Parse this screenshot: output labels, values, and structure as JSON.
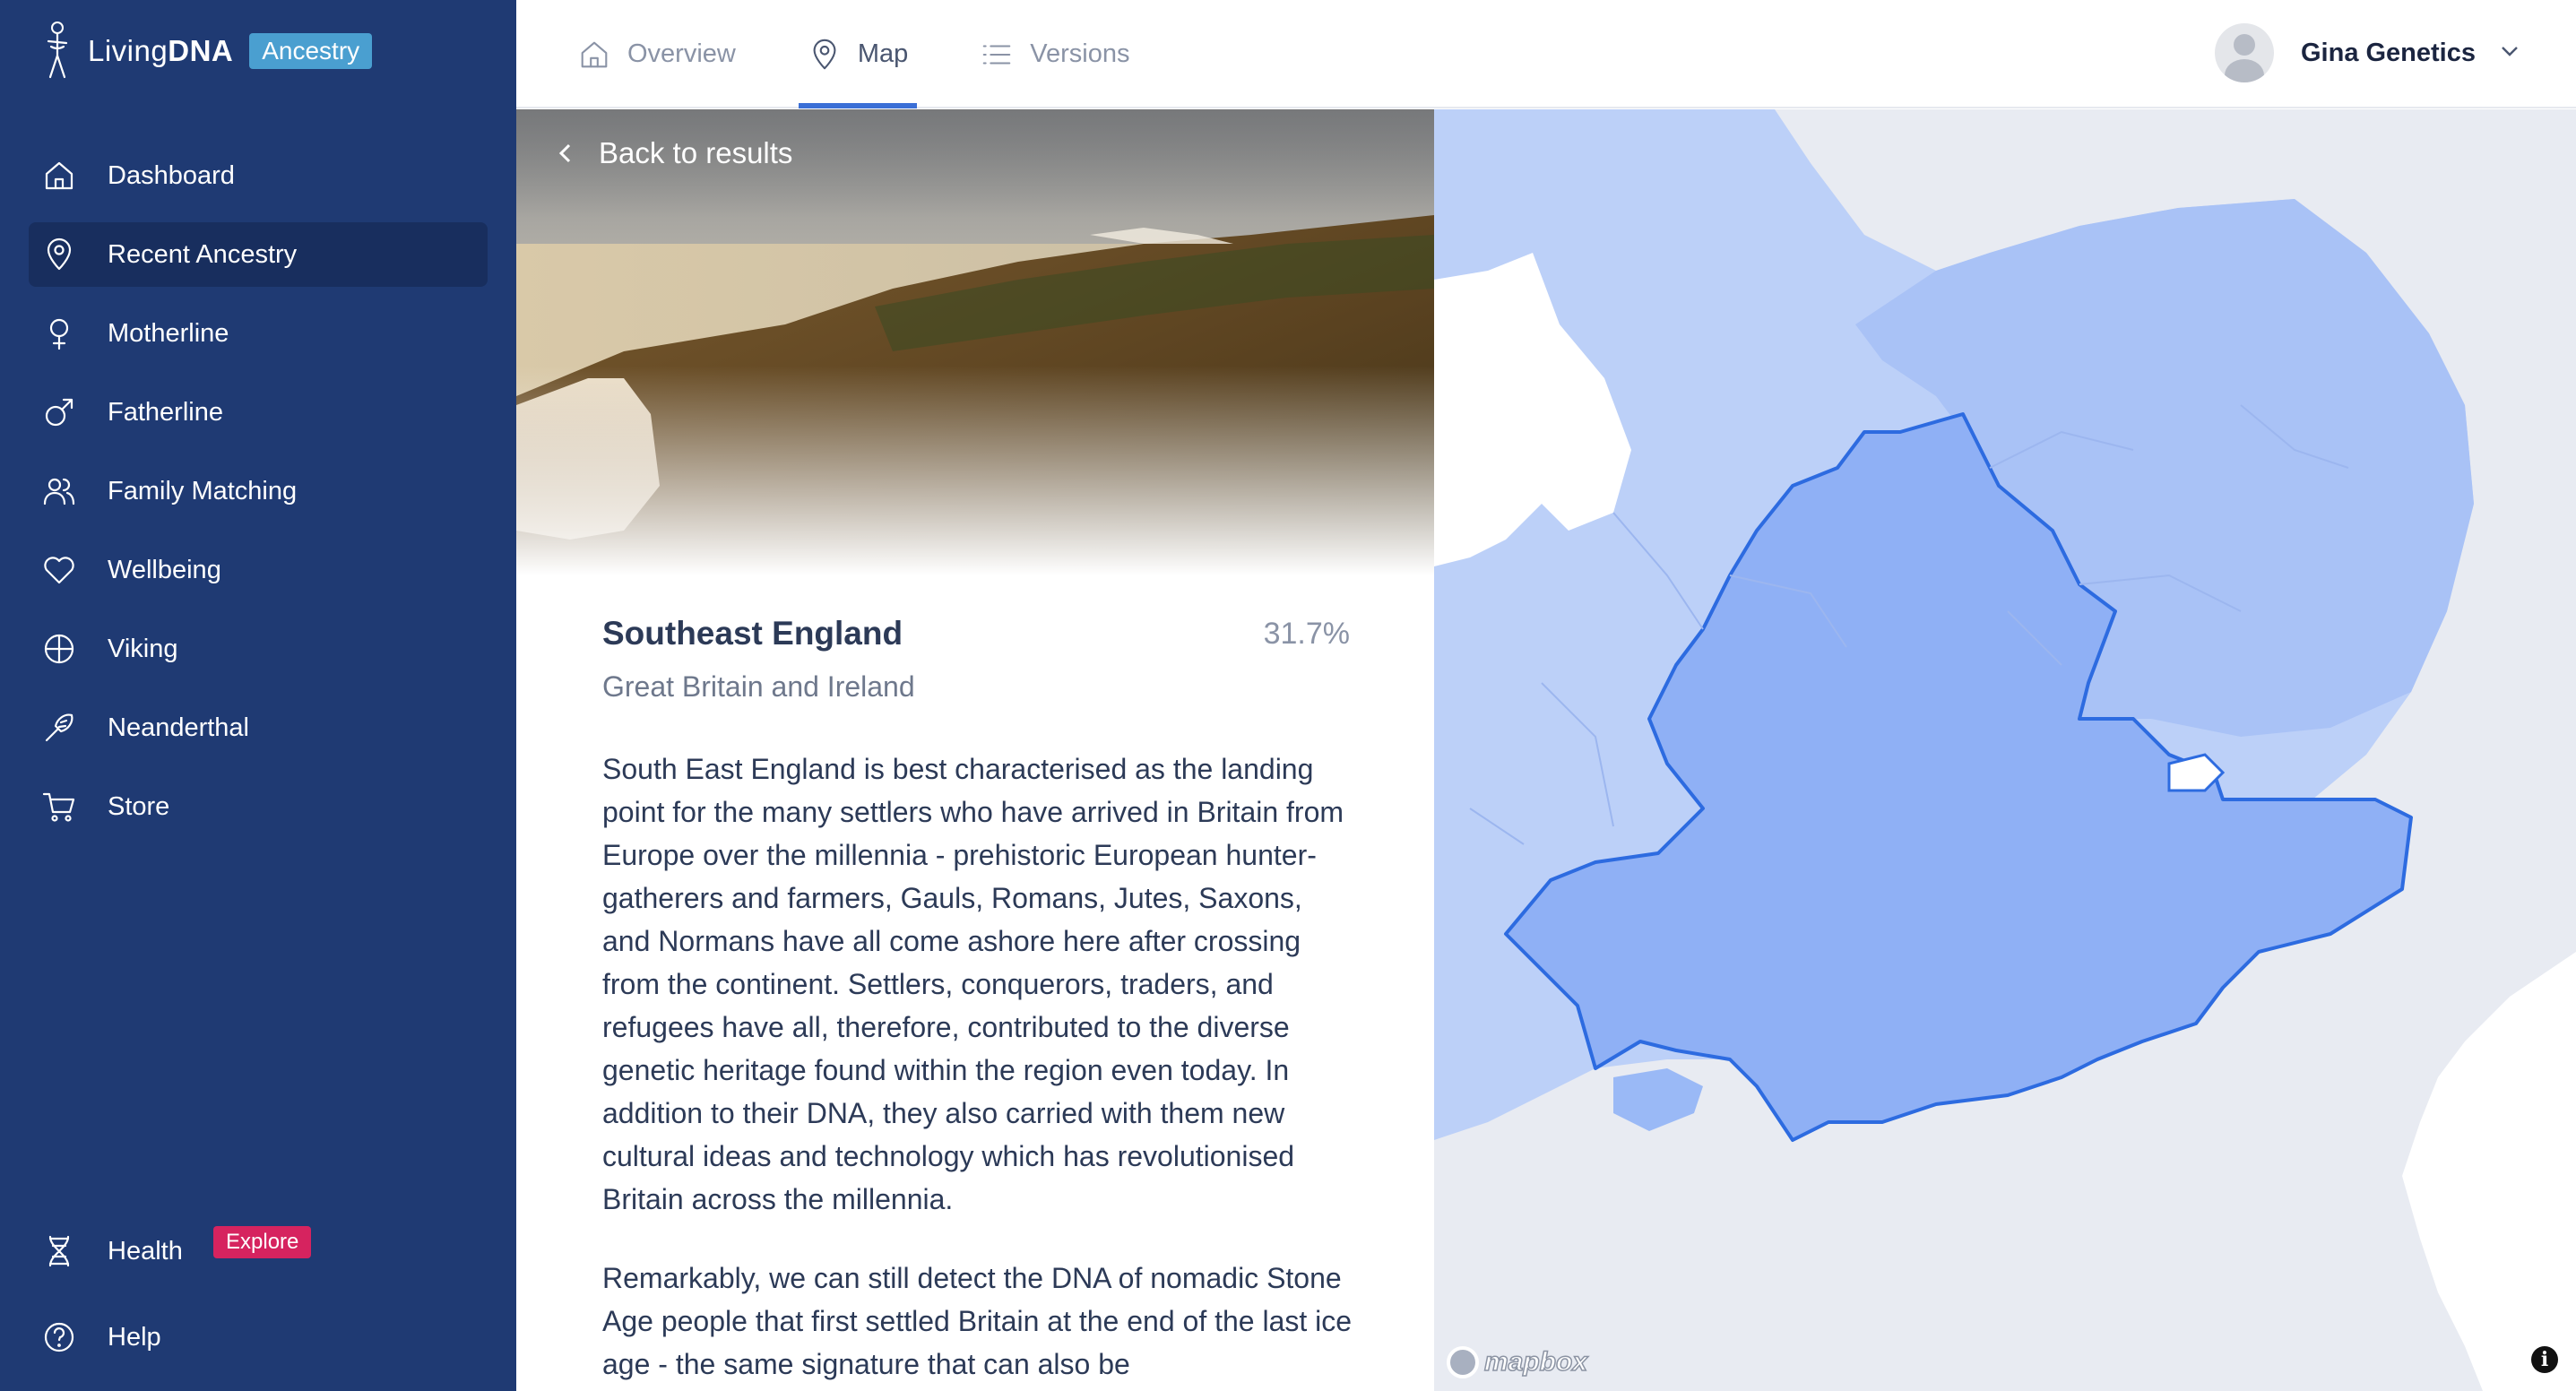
{
  "brand": {
    "name_light": "Living",
    "name_bold": "DNA",
    "badge": "Ancestry"
  },
  "sidebar": {
    "items": [
      {
        "label": "Dashboard",
        "icon": "home-icon"
      },
      {
        "label": "Recent Ancestry",
        "icon": "map-pin-icon",
        "active": true
      },
      {
        "label": "Motherline",
        "icon": "female-icon"
      },
      {
        "label": "Fatherline",
        "icon": "male-icon"
      },
      {
        "label": "Family Matching",
        "icon": "users-icon"
      },
      {
        "label": "Wellbeing",
        "icon": "heart-icon"
      },
      {
        "label": "Viking",
        "icon": "viking-shield-icon"
      },
      {
        "label": "Neanderthal",
        "icon": "neanderthal-icon"
      },
      {
        "label": "Store",
        "icon": "cart-icon"
      }
    ],
    "health": {
      "label": "Health",
      "badge": "Explore",
      "icon": "dna-icon"
    },
    "help": {
      "label": "Help",
      "icon": "help-circle-icon"
    }
  },
  "topbar": {
    "tabs": [
      {
        "label": "Overview",
        "icon": "home-icon"
      },
      {
        "label": "Map",
        "icon": "map-pin-icon",
        "active": true
      },
      {
        "label": "Versions",
        "icon": "list-icon"
      }
    ],
    "user": {
      "name": "Gina Genetics"
    }
  },
  "panel": {
    "back_label": "Back to results",
    "region": {
      "title": "Southeast England",
      "percent": "31.7%",
      "subtitle": "Great Britain and Ireland"
    },
    "paragraphs": [
      "South East England is best characterised as the landing point for the many settlers who have arrived in Britain from Europe over the millennia - prehistoric European hunter-gatherers and farmers, Gauls, Romans, Jutes, Saxons, and Normans have all come ashore here after crossing from the continent. Settlers, conquerors, traders, and refugees have all, therefore, contributed to the diverse genetic heritage found within the region even today. In addition to their DNA, they also carried with them new cultural ideas and technology which has revolutionised Britain across the millennia.",
      "Remarkably, we can still detect the DNA of nomadic Stone Age people that first settled Britain at the end of the last ice age - the same signature that can also be"
    ]
  },
  "map": {
    "attribution": "mapbox",
    "info": "i",
    "colors": {
      "sea": "#e8ebf2",
      "land": "#a9c2f6",
      "highlight": "#8fb0f5",
      "border": "#2d6be0"
    }
  }
}
